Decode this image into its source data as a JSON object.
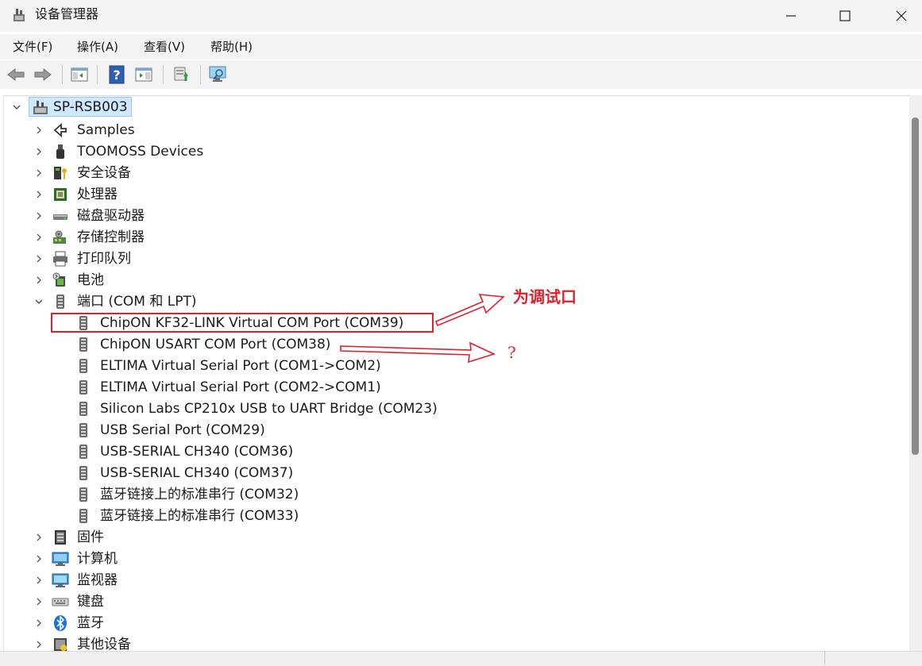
{
  "window": {
    "title": "设备管理器"
  },
  "menu": [
    "文件(F)",
    "操作(A)",
    "查看(V)",
    "帮助(H)"
  ],
  "toolbar": {
    "buttons": [
      "back-icon",
      "forward-icon",
      "show-hide-tree-icon",
      "help-icon",
      "properties-icon",
      "update-driver-icon",
      "scan-hardware-icon"
    ]
  },
  "tree": {
    "root": "SP-RSB003",
    "categories_before": [
      {
        "label": "Samples",
        "icon": "samples-icon"
      },
      {
        "label": "TOOMOSS Devices",
        "icon": "usb-plug-icon"
      },
      {
        "label": "安全设备",
        "icon": "security-device-icon"
      },
      {
        "label": "处理器",
        "icon": "processor-icon"
      },
      {
        "label": "磁盘驱动器",
        "icon": "disk-drive-icon"
      },
      {
        "label": "存储控制器",
        "icon": "storage-controller-icon"
      },
      {
        "label": "打印队列",
        "icon": "printer-icon"
      },
      {
        "label": "电池",
        "icon": "battery-icon"
      }
    ],
    "ports": {
      "label": "端口 (COM 和 LPT)",
      "items": [
        "ChipON KF32-LINK Virtual COM Port (COM39)",
        "ChipON USART COM Port (COM38)",
        "ELTIMA Virtual Serial Port (COM1->COM2)",
        "ELTIMA Virtual Serial Port (COM2->COM1)",
        "Silicon Labs CP210x USB to UART Bridge (COM23)",
        "USB Serial Port (COM29)",
        "USB-SERIAL CH340 (COM36)",
        "USB-SERIAL CH340 (COM37)",
        "蓝牙链接上的标准串行 (COM32)",
        "蓝牙链接上的标准串行 (COM33)"
      ]
    },
    "categories_after": [
      {
        "label": "固件",
        "icon": "firmware-icon"
      },
      {
        "label": "计算机",
        "icon": "computer-icon"
      },
      {
        "label": "监视器",
        "icon": "monitor-icon"
      },
      {
        "label": "键盘",
        "icon": "keyboard-icon"
      },
      {
        "label": "蓝牙",
        "icon": "bluetooth-icon"
      },
      {
        "label": "其他设备",
        "icon": "other-devices-icon"
      }
    ]
  },
  "annotations": {
    "debug_port": "为调试口",
    "question": "?"
  },
  "colors": {
    "annotation": "#e0202a",
    "selection": "#cde8ff"
  }
}
